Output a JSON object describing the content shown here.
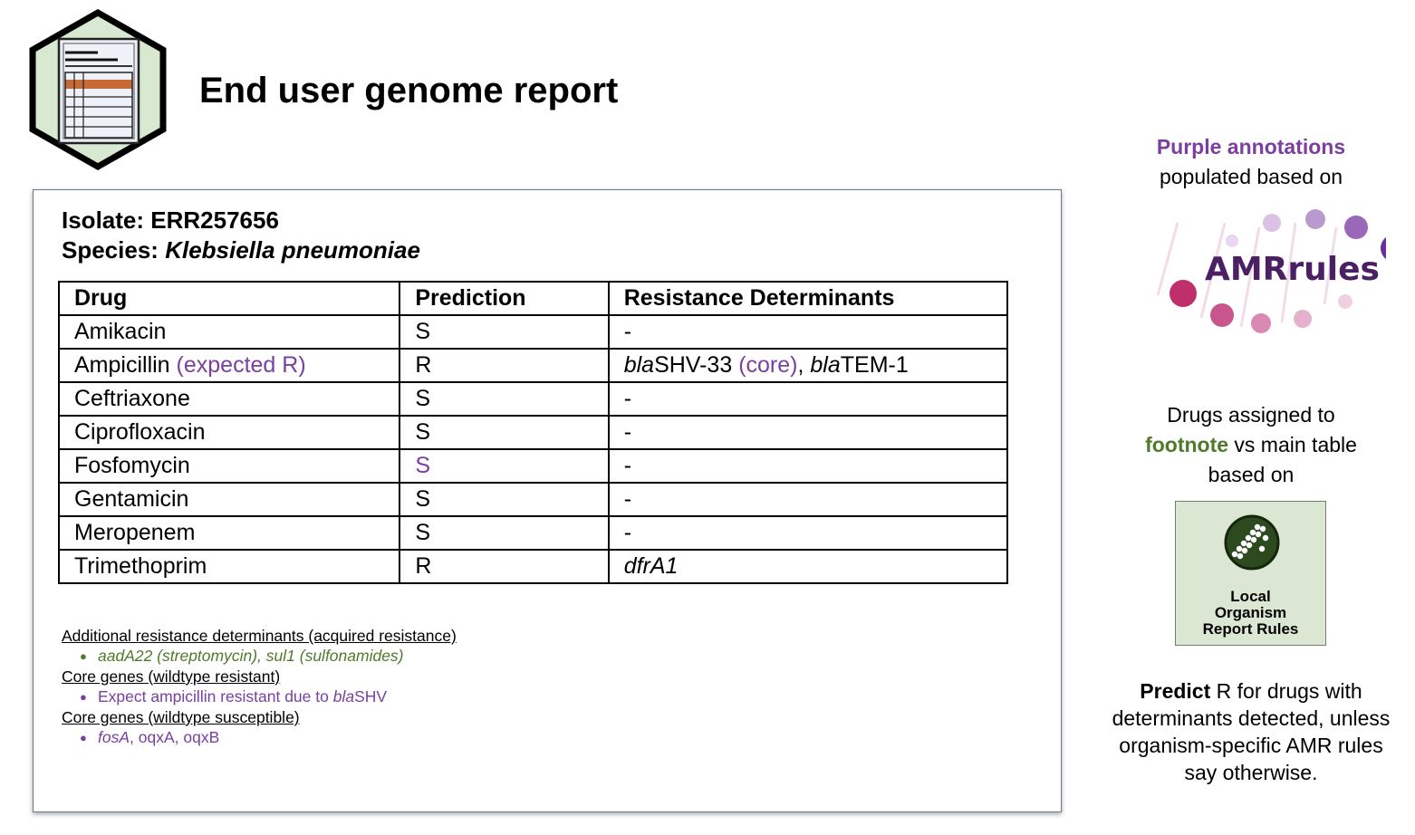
{
  "header": {
    "title": "End user genome report"
  },
  "report": {
    "isolate_label": "Isolate:",
    "isolate_value": "ERR257656",
    "species_label": "Species:",
    "species_value": "Klebsiella pneumoniae",
    "table": {
      "headers": [
        "Drug",
        "Prediction",
        "Resistance Determinants"
      ],
      "rows": [
        {
          "drug": "Amikacin",
          "prediction": "S",
          "determinants": "-"
        },
        {
          "drug": "Ampicillin",
          "drug_note": "(expected R)",
          "prediction": "R",
          "det1_italic": "bla",
          "det1_rest": "SHV-33",
          "det1_note": "(core)",
          "det_sep": ",",
          "det2_italic": "bla",
          "det2_rest": "TEM-1"
        },
        {
          "drug": "Ceftriaxone",
          "prediction": "S",
          "determinants": "-"
        },
        {
          "drug": "Ciprofloxacin",
          "prediction": "S",
          "determinants": "-"
        },
        {
          "drug": "Fosfomycin",
          "prediction": "S",
          "determinants": "-"
        },
        {
          "drug": "Gentamicin",
          "prediction": "S",
          "determinants": "-"
        },
        {
          "drug": "Meropenem",
          "prediction": "S",
          "determinants": "-"
        },
        {
          "drug": "Trimethoprim",
          "prediction": "R",
          "determinants": "dfrA1"
        }
      ]
    },
    "footnotes": {
      "acquired_heading": "Additional resistance determinants (acquired resistance)",
      "acquired_item": "aadA22 (streptomycin), sul1 (sulfonamides)",
      "core_resistant_heading": "Core genes (wildtype resistant)",
      "core_resistant_text": "Expect ampicillin resistant due to ",
      "core_resistant_italic": "bla",
      "core_resistant_tail": "SHV",
      "core_susceptible_heading": "Core genes (wildtype susceptible)",
      "core_susceptible_italic": "fosA",
      "core_susceptible_rest": ", oqxA, oqxB"
    }
  },
  "side": {
    "purple_title": "Purple annotations",
    "purple_rest": "populated based on",
    "amr_logo_text_bold": "AMR",
    "amr_logo_text_rest": "rules",
    "drugs_line1": "Drugs assigned to",
    "drugs_footnote": "footnote",
    "drugs_vs": " vs main table",
    "drugs_line3": "based on",
    "lor_line1": "Local",
    "lor_line2": "Organism",
    "lor_line3": "Report Rules",
    "predict_bold": "Predict",
    "predict_rest1": " R for drugs with",
    "predict_line2": "determinants detected, unless",
    "predict_line3": "organism-specific AMR rules",
    "predict_line4": "say otherwise."
  },
  "colors": {
    "purple": "#7a3fa0",
    "green": "#4e7a2a",
    "logo_hex_fill": "#d9e8d0",
    "table_stripe": "#c86a38"
  },
  "icons": [
    "report-hexagon-icon",
    "amrrules-logo",
    "local-organism-rules-icon"
  ]
}
